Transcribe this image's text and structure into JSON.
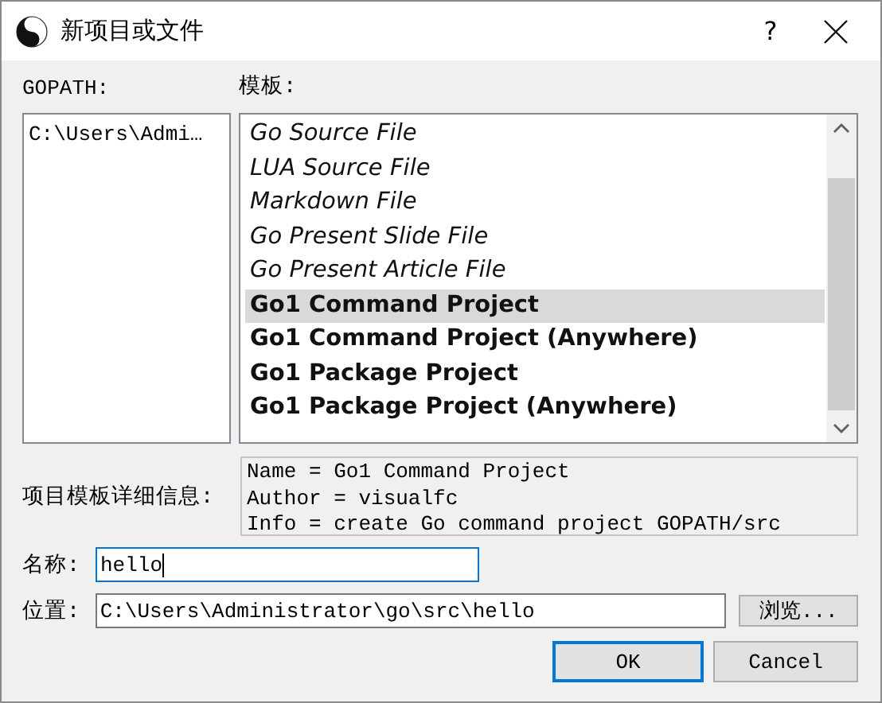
{
  "window": {
    "title": "新项目或文件",
    "help": "?"
  },
  "gopath": {
    "label": "GOPATH:",
    "items": [
      {
        "text": "C:\\Users\\Admi…",
        "selected": false
      }
    ]
  },
  "templates": {
    "label": "模板:",
    "items": [
      {
        "label": "Go Source File",
        "kind": "file",
        "selected": false
      },
      {
        "label": "LUA Source File",
        "kind": "file",
        "selected": false
      },
      {
        "label": "Markdown File",
        "kind": "file",
        "selected": false
      },
      {
        "label": "Go Present Slide File",
        "kind": "file",
        "selected": false
      },
      {
        "label": "Go Present Article File",
        "kind": "file",
        "selected": false
      },
      {
        "label": "Go1 Command Project",
        "kind": "project",
        "selected": true
      },
      {
        "label": "Go1 Command Project (Anywhere)",
        "kind": "project",
        "selected": false
      },
      {
        "label": "Go1 Package Project",
        "kind": "project",
        "selected": false
      },
      {
        "label": "Go1 Package Project (Anywhere)",
        "kind": "project",
        "selected": false
      }
    ]
  },
  "details": {
    "label": "项目模板详细信息:",
    "lines": [
      "Name = Go1 Command Project",
      "Author = visualfc",
      "Info = create Go command project GOPATH/src"
    ]
  },
  "name_field": {
    "label": "名称:",
    "value": "hello",
    "focused": true
  },
  "location_field": {
    "label": "位置:",
    "value": "C:\\Users\\Administrator\\go\\src\\hello",
    "focused": false
  },
  "browse_button": "浏览...",
  "buttons": [
    {
      "label": "OK",
      "default": true
    },
    {
      "label": "Cancel",
      "default": false
    }
  ]
}
